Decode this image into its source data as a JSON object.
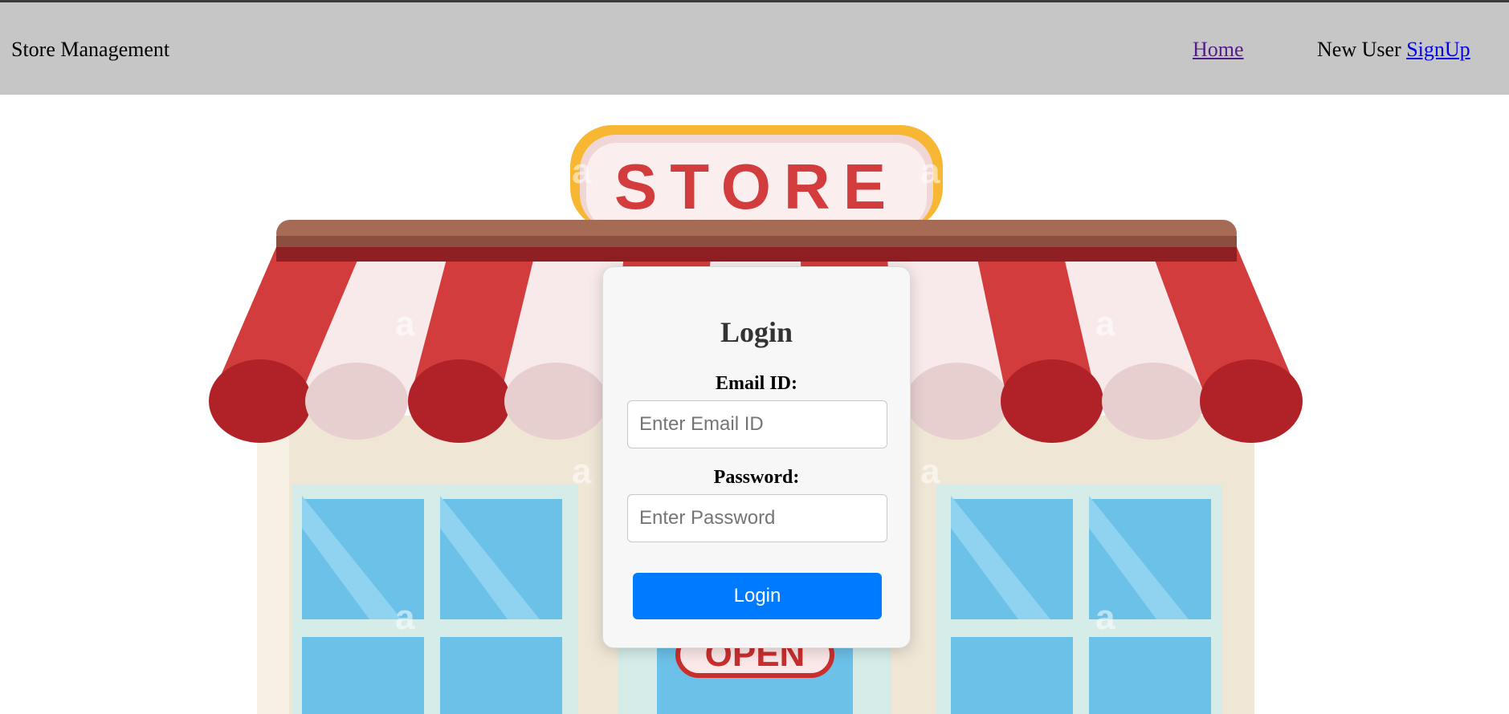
{
  "navbar": {
    "brand": "Store Management",
    "home_link": "Home",
    "signup_prefix": "New User",
    "signup_link": "SignUp"
  },
  "store_image": {
    "sign_text": "STORE",
    "door_sign_text": "OPEN",
    "watermark": "a"
  },
  "login_form": {
    "title": "Login",
    "email_label": "Email ID:",
    "email_placeholder": "Enter Email ID",
    "password_label": "Password:",
    "password_placeholder": "Enter Password",
    "submit_label": "Login"
  },
  "colors": {
    "navbar_bg": "#c6c6c6",
    "button_bg": "#007bff",
    "awning_red": "#d33c3c",
    "sign_border": "#f7b733",
    "window_blue": "#6cc1e8"
  }
}
